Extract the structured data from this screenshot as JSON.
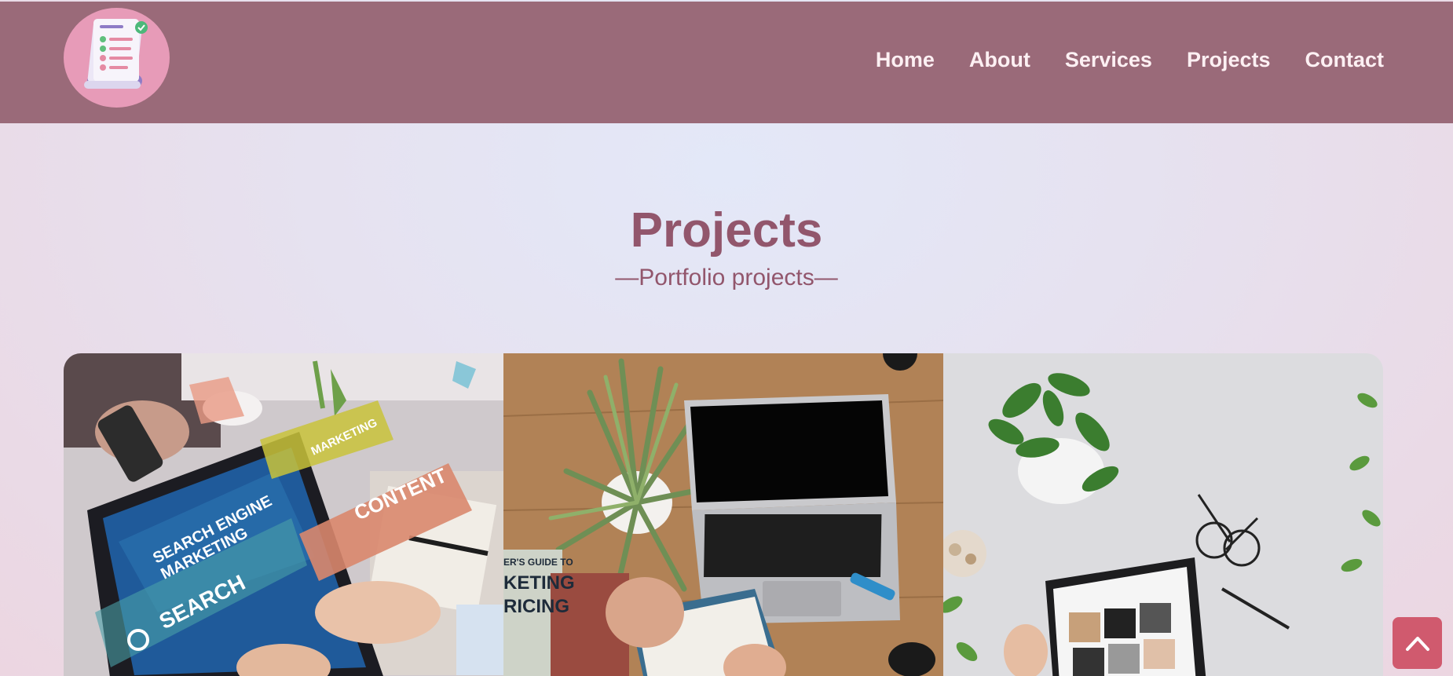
{
  "header": {
    "logo_icon": "checklist-document-icon",
    "nav": [
      {
        "label": "Home"
      },
      {
        "label": "About"
      },
      {
        "label": "Services"
      },
      {
        "label": "Projects"
      },
      {
        "label": "Contact"
      }
    ]
  },
  "hero": {
    "title": "Projects",
    "subtitle": "—Portfolio projects—"
  },
  "gallery": {
    "photos": [
      {
        "icon": "seo-marketing-photo",
        "overlay_texts": [
          "SEARCH ENGINE",
          "MARKETING",
          "CONTENT",
          "MARKETING",
          "SEARCH"
        ]
      },
      {
        "icon": "laptop-desk-photo",
        "overlay_texts": [
          "ER'S GUIDE TO",
          "KETING",
          "RICING"
        ]
      },
      {
        "icon": "tablet-plants-photo",
        "overlay_texts": []
      }
    ]
  },
  "scroll_top": {
    "icon": "chevron-up-icon"
  },
  "colors": {
    "header_bg": "#9a6a79",
    "nav_text": "#fdf0f3",
    "title_text": "#92566c",
    "scroll_btn": "#d05a6e"
  }
}
